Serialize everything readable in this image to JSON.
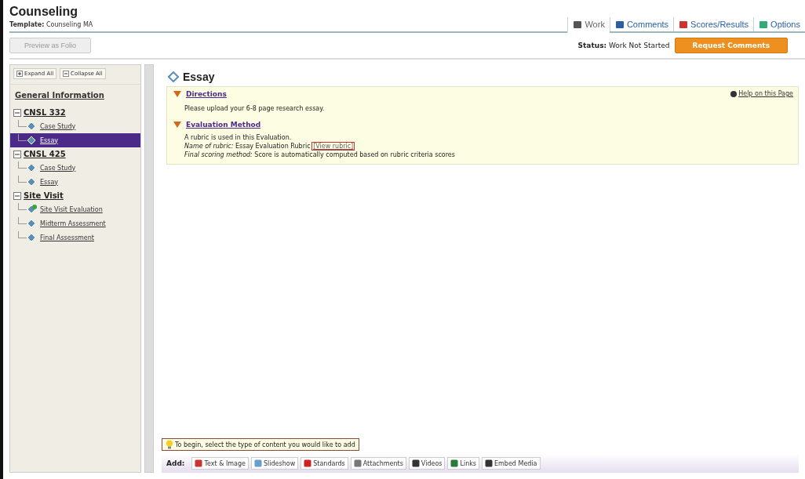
{
  "header": {
    "title": "Counseling",
    "template_label": "Template:",
    "template_value": "Counseling MA"
  },
  "tabs": [
    {
      "label": "Work",
      "selected": true
    },
    {
      "label": "Comments",
      "selected": false
    },
    {
      "label": "Scores/Results",
      "selected": false
    },
    {
      "label": "Options",
      "selected": false
    }
  ],
  "preview_button": "Preview as Folio",
  "status": {
    "label": "Status:",
    "value": "Work Not Started"
  },
  "request_button": "Request Comments",
  "sidebar": {
    "expand_all": "Expand All",
    "collapse_all": "Collapse All",
    "heading": "General Information",
    "groups": [
      {
        "label": "CNSL 332",
        "expanded": true,
        "children": [
          {
            "label": "Case Study",
            "selected": false,
            "kind": "plain"
          },
          {
            "label": "Essay",
            "selected": true,
            "kind": "plain"
          }
        ]
      },
      {
        "label": "CNSL 425",
        "expanded": true,
        "children": [
          {
            "label": "Case Study",
            "selected": false,
            "kind": "plain"
          },
          {
            "label": "Essay",
            "selected": false,
            "kind": "plain"
          }
        ]
      },
      {
        "label": "Site Visit",
        "expanded": true,
        "children": [
          {
            "label": "Site Visit Evaluation",
            "selected": false,
            "kind": "flagged"
          },
          {
            "label": "Midterm Assessment",
            "selected": false,
            "kind": "plain"
          },
          {
            "label": "Final Assessment",
            "selected": false,
            "kind": "plain"
          }
        ]
      }
    ]
  },
  "page": {
    "title": "Essay",
    "help_link": "Help on this Page",
    "sections": [
      {
        "heading": "Directions",
        "expanded": true,
        "lines": [
          "Please upload your 6-8 page research essay."
        ]
      },
      {
        "heading": "Evaluation Method",
        "expanded": true,
        "lines": [
          "A rubric is used in this Evaluation."
        ]
      }
    ],
    "rubric_label": "Name of rubric:",
    "rubric_name": "Essay Evaluation Rubric",
    "rubric_link": "[View rubric]",
    "scoring_label": "Final scoring method:",
    "scoring_value": "Score is automatically computed based on rubric criteria scores"
  },
  "hint": "To begin, select the type of content you would like to add",
  "add_bar": {
    "label": "Add:",
    "buttons": [
      "Text & Image",
      "Slideshow",
      "Standards",
      "Attachments",
      "Videos",
      "Links",
      "Embed Media"
    ]
  }
}
